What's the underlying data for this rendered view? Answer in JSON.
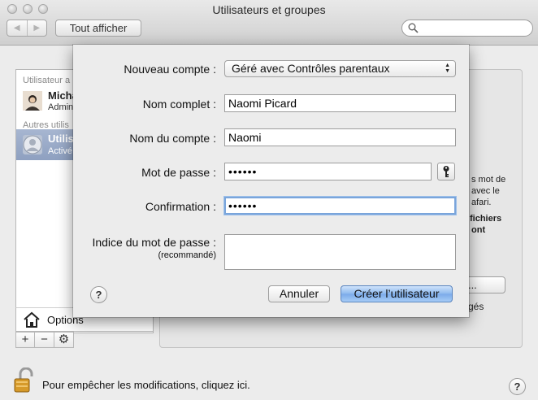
{
  "window": {
    "title": "Utilisateurs et groupes",
    "show_all_label": "Tout afficher",
    "search_placeholder": ""
  },
  "user_list": {
    "current_user_section": "Utilisateur a",
    "current_user_name": "Michael Pinard",
    "current_user_role": "Admin",
    "other_users_section": "Autres utilis",
    "guest_name": "Utilis",
    "guest_status": "Activé",
    "options_label": "Options",
    "add_label": "+",
    "remove_label": "−"
  },
  "background_panel": {
    "text_lines": [
      "s mot de",
      "avec le",
      "afari.",
      "fichiers",
      "ont"
    ],
    "truncated_button_label": "aux...",
    "bottom_text": "gés"
  },
  "lock": {
    "text": "Pour empêcher les modifications, cliquez ici."
  },
  "sheet": {
    "new_account_label": "Nouveau compte :",
    "new_account_value": "Géré avec Contrôles parentaux",
    "full_name_label": "Nom complet :",
    "full_name_value": "Naomi Picard",
    "account_name_label": "Nom du compte :",
    "account_name_value": "Naomi",
    "password_label": "Mot de passe :",
    "password_value": "••••••",
    "confirm_label": "Confirmation :",
    "confirm_value": "••••••",
    "hint_label": "Indice du mot de passe :",
    "hint_sublabel": "(recommandé)",
    "hint_value": "",
    "cancel_label": "Annuler",
    "create_label": "Créer l’utilisateur",
    "help_label": "?"
  },
  "colors": {
    "default_button": "#8cb8ee",
    "focus_ring": "#7aa5db",
    "selection": "#9aabc8"
  }
}
